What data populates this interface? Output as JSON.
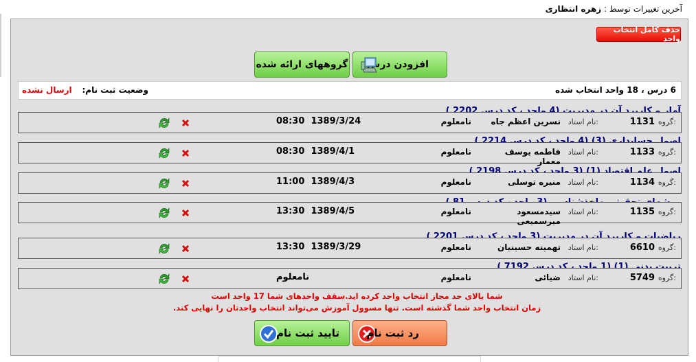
{
  "header": {
    "last_changed_label": "آخرین تغییرات توسط :",
    "last_changed_by": "زهره انتظاری"
  },
  "toolbar": {
    "delete_all_label": "حذف کامل انتخاب واحد",
    "add_course_label": "افزودن درس",
    "offered_groups_label": "گروههای ارائه شده"
  },
  "summary": {
    "count_text": "6 درس ، 18 واحد انتخاب شده",
    "status_label": "وضعیت ثبت نام:",
    "status_value": "ارسال نشده"
  },
  "row_labels": {
    "group_label": "گروه:",
    "teacher_label": "نام استاد:"
  },
  "courses": [
    {
      "title": "آمار و کاربرد آن در مدیریت (4 واحد ، کد درس 2202 )",
      "group": "1131",
      "teacher": "نسرین اعظم جاه",
      "place": "نامعلوم",
      "date": "1389/3/24",
      "time": "08:30"
    },
    {
      "title": "اصول حسابداری (3) (4 واحد ، کد درس 2214 )",
      "group": "1133",
      "teacher": "فاطمه یوسف معمار",
      "place": "نامعلوم",
      "date": "1389/4/1",
      "time": "08:30"
    },
    {
      "title": "اصول علم اقتصاد (1) (3 واحد ، کد درس 2198 )",
      "group": "1134",
      "teacher": "منیره توسلی",
      "place": "نامعلوم",
      "date": "1389/4/3",
      "time": "11:00"
    },
    {
      "title": "روشهای تحقیق وماخذشناسی (3 واحد ، کد درس 81 )",
      "group": "1135",
      "teacher": "سیدمسعود میرسمیعی",
      "place": "نامعلوم",
      "date": "1389/4/5",
      "time": "13:30"
    },
    {
      "title": "ریاضیات و کاربرد آن در مدیریت (3 واحد ، کد درس 2201 )",
      "group": "6610",
      "teacher": "تهمینه حسینیان",
      "place": "نامعلوم",
      "date": "1389/3/29",
      "time": "13:30"
    },
    {
      "title": "تربیت بدنی (1) (1 واحد ، کد درس 7192 )",
      "group": "5749",
      "teacher": "ضیائی",
      "place": "نامعلوم",
      "date": "",
      "time": "",
      "date_text": "نامعلوم"
    }
  ],
  "warnings": {
    "line1": "شما بالای حد مجاز انتخاب واحد کرده اید.سقف واحدهای شما 17 واحد است",
    "line2": "زمان انتخاب واحد شما گذشته است. تنها مسوول آموزش می‌تواند انتخاب واحدتان را نهایی کند."
  },
  "actions": {
    "confirm_label": "تایید ثبت نام",
    "reject_label": "رد ثبت نام"
  },
  "colors": {
    "title_blue": "#00007a",
    "warning_red": "#e00000",
    "green_button": "#6fcf45",
    "red_button": "#f07a45"
  }
}
